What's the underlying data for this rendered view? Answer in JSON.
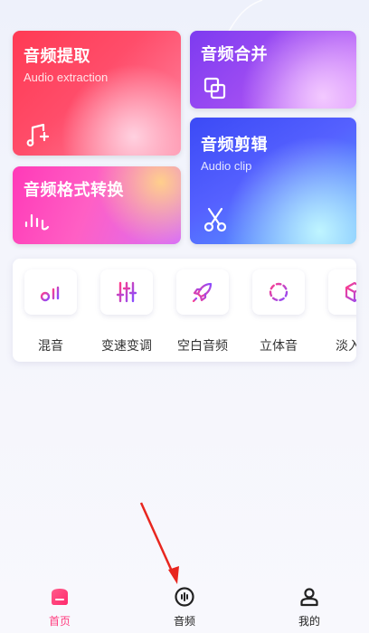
{
  "cards": {
    "extract": {
      "title": "音频提取",
      "subtitle": "Audio extraction",
      "icon": "music-note-plus-icon"
    },
    "merge": {
      "title": "音频合并",
      "icon": "overlap-squares-icon"
    },
    "clip": {
      "title": "音频剪辑",
      "subtitle": "Audio clip",
      "icon": "scissors-icon"
    },
    "convert": {
      "title": "音频格式转换",
      "icon": "waveform-icon"
    }
  },
  "tools": [
    {
      "label": "混音",
      "icon": "mix-note-icon"
    },
    {
      "label": "变速变调",
      "icon": "equalizer-sliders-icon"
    },
    {
      "label": "空白音频",
      "icon": "rocket-icon"
    },
    {
      "label": "立体音",
      "icon": "dashed-circle-icon"
    },
    {
      "label": "淡入淡",
      "icon": "cube-icon"
    }
  ],
  "tabbar": {
    "items": [
      {
        "label": "首页",
        "icon": "home-icon",
        "active": true
      },
      {
        "label": "音频",
        "icon": "audio-disc-icon",
        "active": false
      },
      {
        "label": "我的",
        "icon": "user-icon",
        "active": false
      }
    ]
  },
  "colors": {
    "accent_pink": "#ff3d7f",
    "tool_icon_gradient_start": "#ff3d8b",
    "tool_icon_gradient_end": "#8a4bff",
    "arrow_red": "#e8261f"
  }
}
